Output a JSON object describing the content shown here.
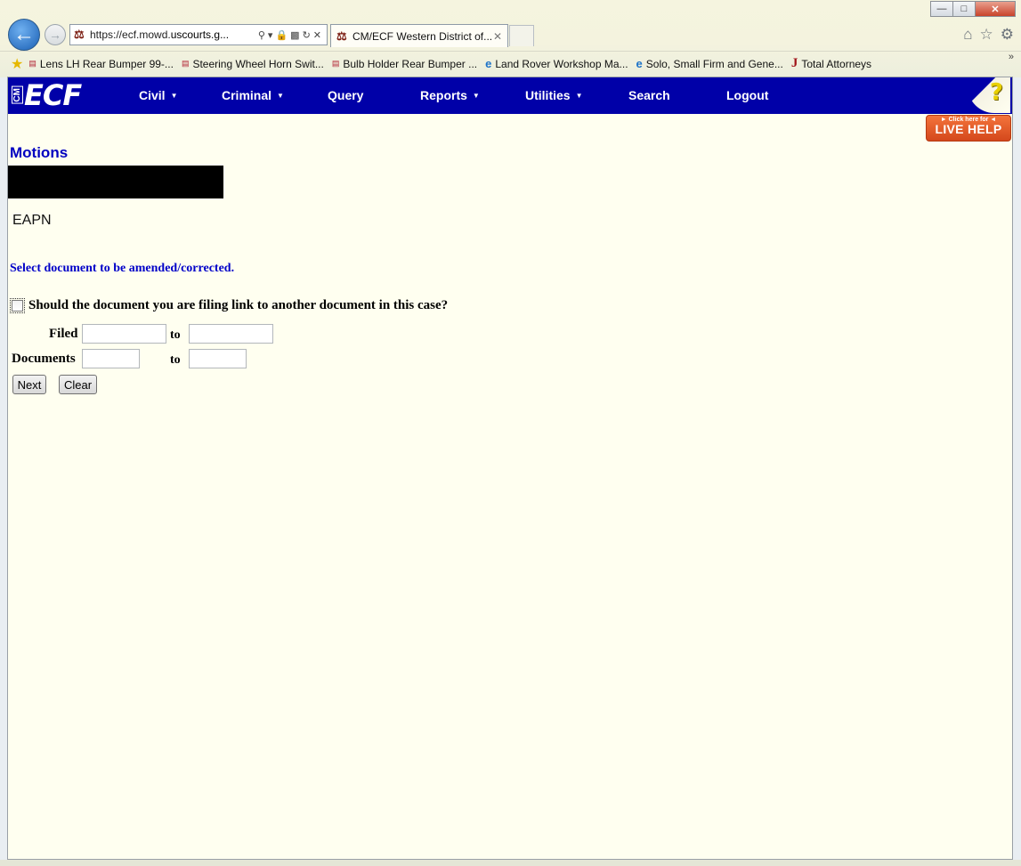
{
  "browser": {
    "address_url_prefix": "https://ecf.mowd.",
    "address_url_domain": "uscourts.g...",
    "tab_title": "CM/ECF Western District of...",
    "favorites": [
      {
        "label": "Lens LH Rear Bumper 99-...",
        "icon": "uk-flag-icon"
      },
      {
        "label": "Steering Wheel Horn Swit...",
        "icon": "uk-flag-icon"
      },
      {
        "label": "Bulb Holder Rear Bumper ...",
        "icon": "uk-flag-icon"
      },
      {
        "label": "Land Rover Workshop Ma...",
        "icon": "ie-page-icon"
      },
      {
        "label": "Solo, Small Firm and Gene...",
        "icon": "ie-page-icon"
      },
      {
        "label": "Total Attorneys",
        "icon": "total-attorneys-icon"
      }
    ]
  },
  "ecf": {
    "logo_cm": "CM",
    "logo_ecf": "ECF",
    "menu": [
      {
        "label": "Civil",
        "has_dropdown": true
      },
      {
        "label": "Criminal",
        "has_dropdown": true
      },
      {
        "label": "Query",
        "has_dropdown": false
      },
      {
        "label": "Reports",
        "has_dropdown": true
      },
      {
        "label": "Utilities",
        "has_dropdown": true
      },
      {
        "label": "Search",
        "has_dropdown": false
      },
      {
        "label": "Logout",
        "has_dropdown": false
      }
    ],
    "help_symbol": "?",
    "live_help_small": "► Click here for ◄",
    "live_help_big": "LIVE HELP"
  },
  "page": {
    "title": "Motions",
    "case_type": "EAPN",
    "select_doc_heading": "Select document to be amended/corrected.",
    "link_question": "Should the document you are filing link to another document in this case?",
    "link_checked": false,
    "filed_label": "Filed",
    "documents_label": "Documents",
    "to_label": "to",
    "filed_from": "",
    "filed_to": "",
    "documents_from": "",
    "documents_to": "",
    "next_button": "Next",
    "clear_button": "Clear"
  },
  "colors": {
    "ecf_bar": "#0000a8",
    "page_background": "#fffff0",
    "heading_blue": "#0000c0",
    "live_help_orange": "#e45a28"
  }
}
